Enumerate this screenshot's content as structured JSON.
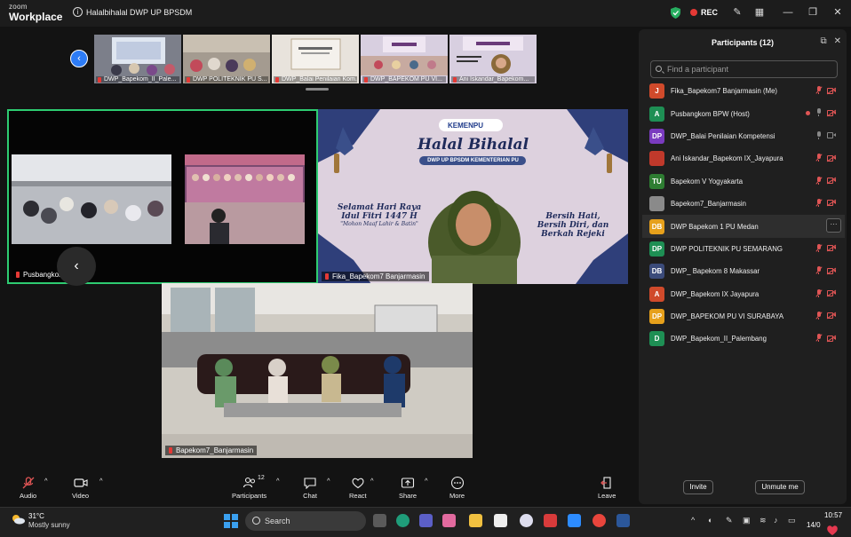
{
  "titlebar": {
    "brand_small": "zoom",
    "brand": "Workplace",
    "meeting_title": "Halalbihalal DWP UP BPSDM",
    "rec_label": "REC"
  },
  "thumbnails": [
    {
      "label": "DWP_Bapekom_II_Pale..."
    },
    {
      "label": "DWP POLITEKNIK PU S..."
    },
    {
      "label": "DWP_Balai Penilaian Kom..."
    },
    {
      "label": "DWP_BAPEKOM PU VI..."
    },
    {
      "label": "Ani Iskandar_Bapekom..."
    }
  ],
  "tiles": {
    "a": {
      "name": "Pusbangkom BPW"
    },
    "b": {
      "name": "Fika_Bapekom7 Banjarmasin",
      "logo": "KEMENPU",
      "title": "Halal Bihalal",
      "subtitle": "DWP UP BPSDM KEMENTERIAN PU",
      "greeting_line1": "Selamat Hari Raya",
      "greeting_line2": "Idul Fitri 1447 H",
      "greeting_line3": "\"Mohon Maaf Lahir & Batin\"",
      "motto_line1": "Bersih Hati,",
      "motto_line2": "Bersih Diri, dan",
      "motto_line3": "Berkah Rejeki"
    },
    "c": {
      "name": "Bapekom7_Banjarmasin"
    }
  },
  "participants_panel": {
    "title": "Participants (12)",
    "search_placeholder": "Find a participant",
    "invite_label": "Invite",
    "unmute_label": "Unmute me",
    "list": [
      {
        "initials": "J",
        "name": "Fika_Bapekom7 Banjarmasin (Me)",
        "color": "#d04a2b"
      },
      {
        "initials": "A",
        "name": "Pusbangkom BPW (Host)",
        "color": "#1e8f54"
      },
      {
        "initials": "DP",
        "name": "DWP_Balai Penilaian Kompetensi",
        "color": "#7a3bbf"
      },
      {
        "initials": "",
        "name": "Ani Iskandar_Bapekom IX_Jayapura",
        "color": "#c0392b"
      },
      {
        "initials": "TU",
        "name": "Bapekom V Yogyakarta",
        "color": "#2e7d32"
      },
      {
        "initials": "",
        "name": "Bapekom7_Banjarmasin",
        "color": "#8a8a8a"
      },
      {
        "initials": "DB",
        "name": "DWP Bapekom 1 PU Medan",
        "color": "#e6a01b"
      },
      {
        "initials": "DP",
        "name": "DWP POLITEKNIK PU SEMARANG",
        "color": "#1e8f54"
      },
      {
        "initials": "DB",
        "name": "DWP_ Bapekom 8 Makassar",
        "color": "#3b4b7a"
      },
      {
        "initials": "A",
        "name": "DWP_Bapekom IX Jayapura",
        "color": "#d04a2b"
      },
      {
        "initials": "DP",
        "name": "DWP_BAPEKOM PU VI SURABAYA",
        "color": "#e6a01b"
      },
      {
        "initials": "D",
        "name": "DWP_Bapekom_II_Palembang",
        "color": "#1e8f54"
      }
    ]
  },
  "toolbar": {
    "audio": "Audio",
    "video": "Video",
    "participants": "Participants",
    "participants_count": "12",
    "chat": "Chat",
    "react": "React",
    "share": "Share",
    "more": "More",
    "leave": "Leave"
  },
  "taskbar": {
    "temp": "31°C",
    "weather": "Mostly sunny",
    "search": "Search",
    "time": "10:57",
    "date": "14/0"
  }
}
